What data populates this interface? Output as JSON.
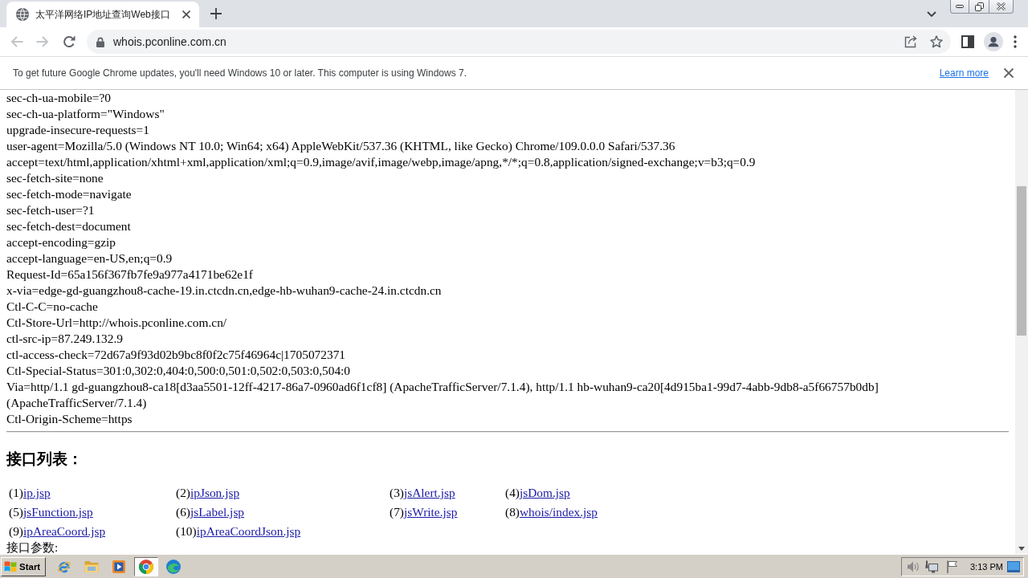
{
  "browser": {
    "tabs": [
      {
        "title": "太平洋网络IP地址查询Web接口",
        "selected": true
      }
    ],
    "back": {
      "disabled": true
    },
    "forward": {
      "disabled": true
    },
    "address": "whois.pconline.com.cn"
  },
  "infobar": {
    "message": "To get future Google Chrome updates, you'll need Windows 10 or later. This computer is using Windows 7.",
    "link": "Learn more"
  },
  "page": {
    "lines": [
      "sec-ch-ua-mobile=?0",
      "sec-ch-ua-platform=\"Windows\"",
      "upgrade-insecure-requests=1",
      "user-agent=Mozilla/5.0 (Windows NT 10.0; Win64; x64) AppleWebKit/537.36 (KHTML, like Gecko) Chrome/109.0.0.0 Safari/537.36",
      "accept=text/html,application/xhtml+xml,application/xml;q=0.9,image/avif,image/webp,image/apng,*/*;q=0.8,application/signed-exchange;v=b3;q=0.9",
      "sec-fetch-site=none",
      "sec-fetch-mode=navigate",
      "sec-fetch-user=?1",
      "sec-fetch-dest=document",
      "accept-encoding=gzip",
      "accept-language=en-US,en;q=0.9",
      "Request-Id=65a156f367fb7fe9a977a4171be62e1f",
      "x-via=edge-gd-guangzhou8-cache-19.in.ctcdn.cn,edge-hb-wuhan9-cache-24.in.ctcdn.cn",
      "Ctl-C-C=no-cache",
      "Ctl-Store-Url=http://whois.pconline.com.cn/",
      "ctl-src-ip=87.249.132.9",
      "ctl-access-check=72d67a9f93d02b9bc8f0f2c75f46964c|1705072371",
      "Ctl-Special-Status=301:0,302:0,404:0,500:0,501:0,502:0,503:0,504:0",
      "Via=http/1.1 gd-guangzhou8-ca18[d3aa5501-12ff-4217-86a7-0960ad6f1cf8] (ApacheTrafficServer/7.1.4), http/1.1 hb-wuhan9-ca20[4d915ba1-99d7-4abb-9db8-a5f66757b0db] (ApacheTrafficServer/7.1.4)",
      "Ctl-Origin-Scheme=https"
    ],
    "heading": "接口列表：",
    "interfaces": [
      {
        "number": "(1)",
        "link": "ip.jsp"
      },
      {
        "number": "(2)",
        "link": "ipJson.jsp"
      },
      {
        "number": "(3)",
        "link": "jsAlert.jsp"
      },
      {
        "number": "(4)",
        "link": "jsDom.jsp"
      },
      {
        "number": "(5)",
        "link": "jsFunction.jsp"
      },
      {
        "number": "(6)",
        "link": "jsLabel.jsp"
      },
      {
        "number": "(7)",
        "link": "jsWrite.jsp"
      },
      {
        "number": "(8)",
        "link": "whois/index.jsp"
      },
      {
        "number": "(9)",
        "link": "ipAreaCoord.jsp"
      },
      {
        "number": "(10)",
        "link": "ipAreaCoordJson.jsp"
      }
    ],
    "parameters_label": "接口参数:"
  },
  "taskbar": {
    "start": "Start",
    "buttons": [
      {
        "selected": false
      },
      {
        "selected": false
      },
      {
        "selected": false
      },
      {
        "selected": true
      },
      {
        "selected": false
      }
    ],
    "clock": "3:13 PM"
  }
}
